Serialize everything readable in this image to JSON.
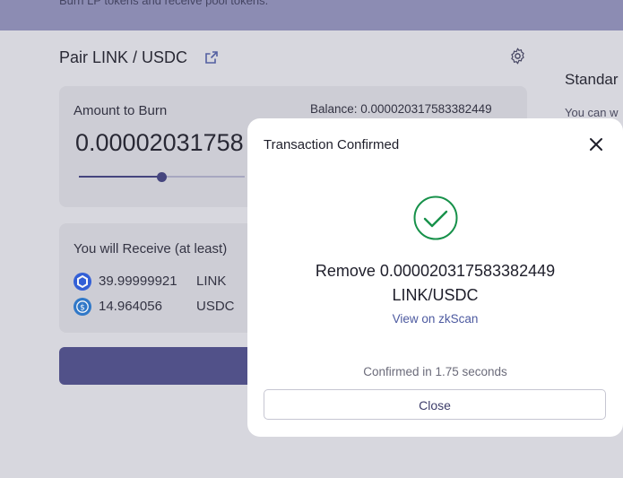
{
  "banner": {
    "text": "Burn LP tokens and receive pool tokens."
  },
  "pair": {
    "title": "Pair LINK / USDC"
  },
  "right_panel": {
    "title": "Standar",
    "subtitle": "You can w"
  },
  "burn_card": {
    "label": "Amount to Burn",
    "balance": "Balance: 0.000020317583382449",
    "amount": "0.00002031758",
    "slider_fraction": 0.5
  },
  "receive_card": {
    "label": "You will Receive (at least)",
    "tokens": [
      {
        "amount": "39.99999921",
        "symbol": "LINK",
        "icon": "link-token-icon"
      },
      {
        "amount": "14.964056",
        "symbol": "USDC",
        "icon": "usdc-token-icon"
      }
    ]
  },
  "modal": {
    "title": "Transaction Confirmed",
    "remove_line1": "Remove 0.000020317583382449",
    "remove_line2": "LINK/USDC",
    "link_text": "View on zkScan",
    "confirmed_text": "Confirmed in 1.75 seconds",
    "close_label": "Close"
  },
  "colors": {
    "accent": "#4a4a86",
    "success": "#17914a",
    "link_token": "#2a5ada",
    "usdc_token": "#2775ca"
  }
}
